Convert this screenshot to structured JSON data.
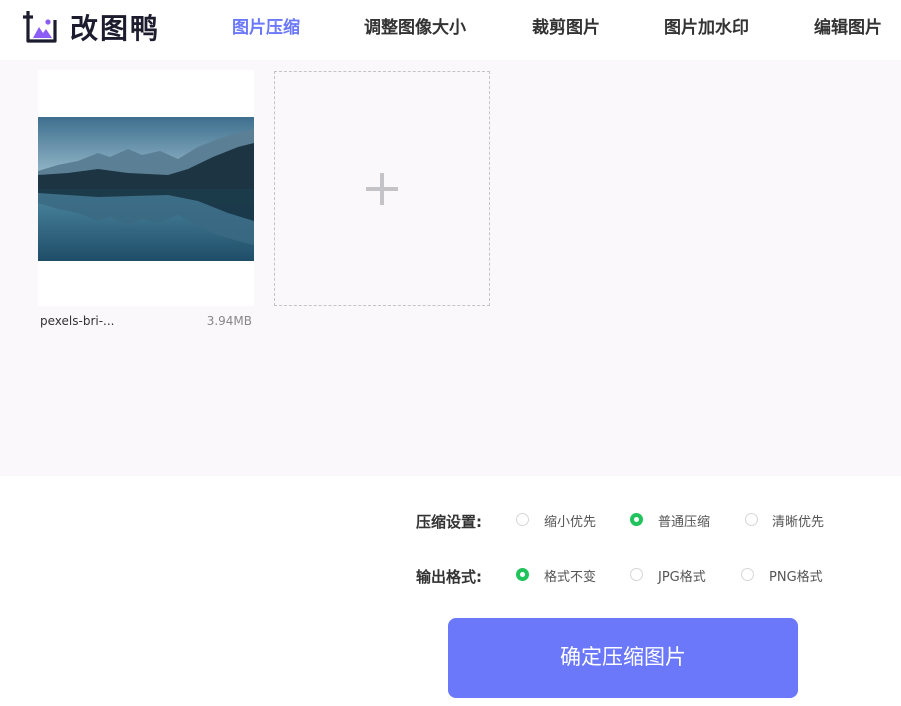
{
  "app": {
    "logo_text": "改图鸭",
    "brand_color": "#6b78fa"
  },
  "nav": {
    "items": [
      {
        "label": "图片压缩",
        "active": true
      },
      {
        "label": "调整图像大小",
        "active": false
      },
      {
        "label": "裁剪图片",
        "active": false
      },
      {
        "label": "图片加水印",
        "active": false
      },
      {
        "label": "编辑图片",
        "active": false
      }
    ]
  },
  "upload": {
    "files": [
      {
        "name": "pexels-bri-...",
        "size": "3.94MB"
      }
    ],
    "add_icon": "plus-icon"
  },
  "settings": {
    "compress": {
      "label": "压缩设置:",
      "options": [
        "缩小优先",
        "普通压缩",
        "清晰优先"
      ],
      "selected": "普通压缩"
    },
    "format": {
      "label": "输出格式:",
      "options": [
        "格式不变",
        "JPG格式",
        "PNG格式"
      ],
      "selected": "格式不变"
    }
  },
  "actions": {
    "confirm_label": "确定压缩图片"
  }
}
